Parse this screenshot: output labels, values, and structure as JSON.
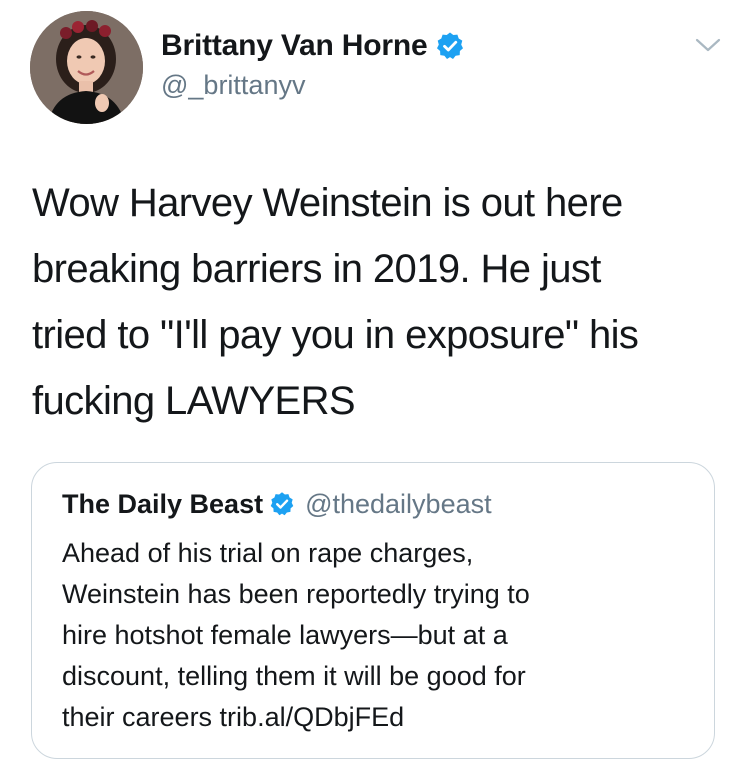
{
  "tweet": {
    "author": {
      "name": "Brittany Van Horne",
      "handle": "@_brittanyv",
      "verified": true,
      "avatar_icon": "user-avatar-photo"
    },
    "text_lines": [
      "Wow Harvey Weinstein is out here",
      "breaking barriers in 2019. He just",
      "tried to \"I'll pay you in exposure\" his",
      "fucking LAWYERS"
    ],
    "menu_icon": "chevron-down-icon"
  },
  "quoted_tweet": {
    "author": {
      "name": "The Daily Beast",
      "handle": "@thedailybeast",
      "verified": true
    },
    "text_lines": [
      "Ahead of his trial on rape charges,",
      "Weinstein has been reportedly trying to",
      "hire hotshot female lawyers—but at a",
      "discount, telling them it will be good for",
      "their careers trib.al/QDbjFEd"
    ]
  },
  "colors": {
    "verified_badge": "#1da1f2",
    "secondary_text": "#657786",
    "primary_text": "#14171a",
    "card_border": "#ccd6dd"
  }
}
